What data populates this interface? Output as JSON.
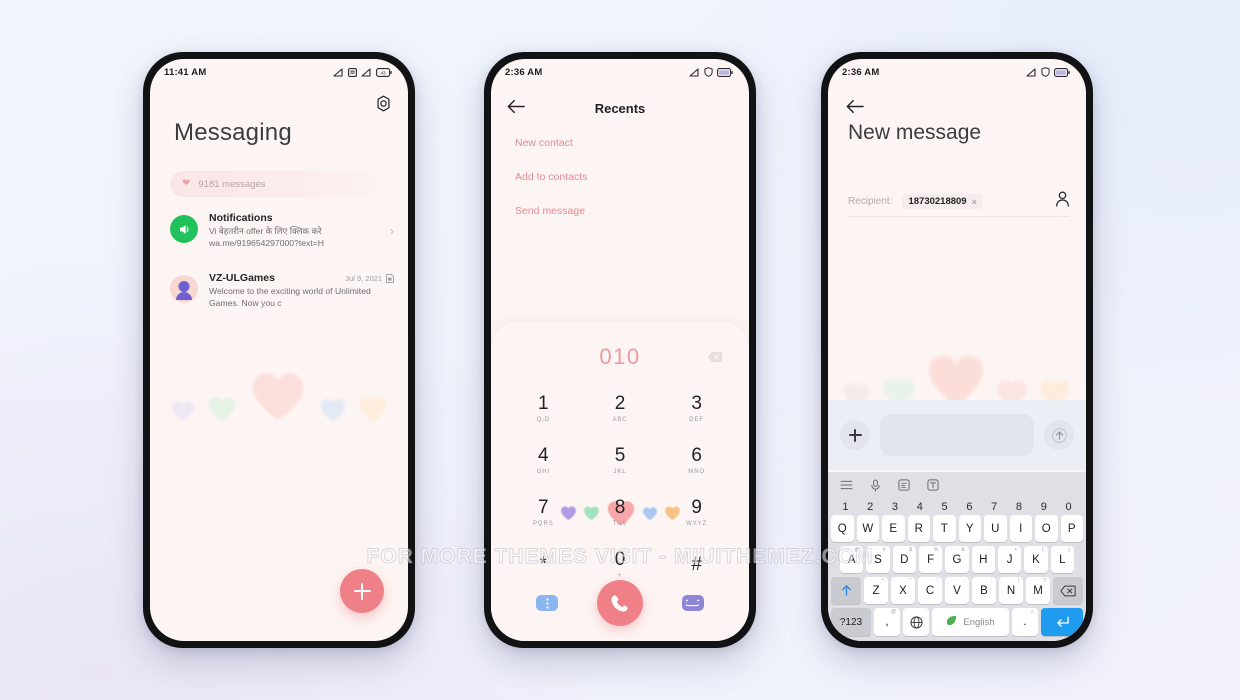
{
  "watermark": "FOR MORE THEMES VISIT - MIUITHEMEZ.COM",
  "theme": {
    "accent_pink": "#f08088",
    "screen_bg": "#fdf5f3",
    "chip_pink": "#fae6e6",
    "menu_red": "#e58b92",
    "keyboard_bg": "#dfe0e5",
    "enter_blue": "#1f9bf0",
    "page_bg": "#f0f3fc"
  },
  "phone1": {
    "statusbar": {
      "time": "11:41 AM",
      "icons": [
        "signal-icon",
        "sim-icon",
        "signal-icon",
        "battery-icon"
      ]
    },
    "gear_icon": "gear-icon",
    "title": "Messaging",
    "chip": {
      "icon": "heart-icon",
      "label": "9181 messages"
    },
    "conversations": [
      {
        "avatar": "speaker-icon",
        "name": "Notifications",
        "preview": "Vi बेहतरीन offer के लिए क्लिक करे wa.me/919654297000?text=H",
        "date": "",
        "chevron": "chevron-right-icon"
      },
      {
        "avatar": "person-avatar",
        "name": "VZ-ULGames",
        "preview": "Welcome to the exciting world of Unlimited Games. Now you c",
        "date": "Jul 9, 2021",
        "date_icon": "sim-card-icon"
      }
    ],
    "hearts": [
      "#efe8f3",
      "#e4f2e6",
      "#fbdedb",
      "#e2e9f6",
      "#fdeedc"
    ],
    "fab": {
      "icon": "plus-icon",
      "label": "New conversation"
    }
  },
  "phone2": {
    "statusbar": {
      "time": "2:36 AM",
      "icons": [
        "signal-icon",
        "shield-icon",
        "battery-icon"
      ]
    },
    "back_icon": "arrow-left-icon",
    "title": "Recents",
    "menu": [
      "New contact",
      "Add to contacts",
      "Send message"
    ],
    "dialer": {
      "number": "010",
      "delete_icon": "backspace-icon",
      "keys": [
        {
          "digit": "1",
          "letters": "Q,D"
        },
        {
          "digit": "2",
          "letters": "ABC"
        },
        {
          "digit": "3",
          "letters": "DEF"
        },
        {
          "digit": "4",
          "letters": "GHI"
        },
        {
          "digit": "5",
          "letters": "JKL"
        },
        {
          "digit": "6",
          "letters": "MNO"
        },
        {
          "digit": "7",
          "letters": "PQRS"
        },
        {
          "digit": "8",
          "letters": "TUV"
        },
        {
          "digit": "9",
          "letters": "WXYZ"
        },
        {
          "digit": "*",
          "letters": ""
        },
        {
          "digit": "0",
          "letters": "+"
        },
        {
          "digit": "#",
          "letters": ""
        }
      ],
      "hearts": [
        "#a48ce6",
        "#93dfb4",
        "#f79a9a",
        "#9cc0f2",
        "#f5ba72"
      ],
      "actions": {
        "left_icon": "more-vert-icon",
        "call_icon": "phone-icon",
        "right_icon": "voicemail-icon"
      }
    }
  },
  "phone3": {
    "statusbar": {
      "time": "2:36 AM",
      "icons": [
        "signal-icon",
        "shield-icon",
        "battery-icon"
      ]
    },
    "back_icon": "arrow-left-icon",
    "title": "New message",
    "recipient": {
      "label": "Recipient:",
      "token": "18730218809",
      "remove_icon": "close-icon",
      "contacts_icon": "person-icon"
    },
    "hearts": [
      "#f2ece8",
      "#e6f3e8",
      "#fcdcd6",
      "#fae4e0",
      "#fdecd9"
    ],
    "compose": {
      "plus_icon": "plus-icon",
      "placeholder": "",
      "send_icon": "arrow-up-icon"
    },
    "keyboard": {
      "toolbar": [
        "menu-icon",
        "microphone-icon",
        "clipboard-icon",
        "text-icon"
      ],
      "numbers": [
        "1",
        "2",
        "3",
        "4",
        "5",
        "6",
        "7",
        "8",
        "9",
        "0"
      ],
      "row1": [
        {
          "k": "Q",
          "s": ""
        },
        {
          "k": "W",
          "s": ""
        },
        {
          "k": "E",
          "s": ""
        },
        {
          "k": "R",
          "s": ""
        },
        {
          "k": "T",
          "s": ""
        },
        {
          "k": "Y",
          "s": ""
        },
        {
          "k": "U",
          "s": ""
        },
        {
          "k": "I",
          "s": ""
        },
        {
          "k": "O",
          "s": ""
        },
        {
          "k": "P",
          "s": ""
        }
      ],
      "row2": [
        {
          "k": "A",
          "s": "@"
        },
        {
          "k": "S",
          "s": "#"
        },
        {
          "k": "D",
          "s": "$"
        },
        {
          "k": "F",
          "s": "%"
        },
        {
          "k": "G",
          "s": "&"
        },
        {
          "k": "H",
          "s": "-"
        },
        {
          "k": "J",
          "s": "+"
        },
        {
          "k": "K",
          "s": "("
        },
        {
          "k": "L",
          "s": ")"
        }
      ],
      "row3": [
        {
          "k": "Z",
          "s": "*"
        },
        {
          "k": "X",
          "s": "\""
        },
        {
          "k": "C",
          "s": "'"
        },
        {
          "k": "V",
          "s": ":"
        },
        {
          "k": "B",
          "s": ";"
        },
        {
          "k": "N",
          "s": "!"
        },
        {
          "k": "M",
          "s": "?"
        }
      ],
      "shift_icon": "shift-up-icon",
      "backspace_icon": "backspace-icon",
      "symbols_key": "?123",
      "emoji_key": "@",
      "comma_key": ",",
      "globe_icon": "globe-icon",
      "space_label": "English",
      "space_icon": "leaf-icon",
      "period_key": ".",
      "period_sup": "♫",
      "enter_icon": "enter-icon"
    }
  }
}
